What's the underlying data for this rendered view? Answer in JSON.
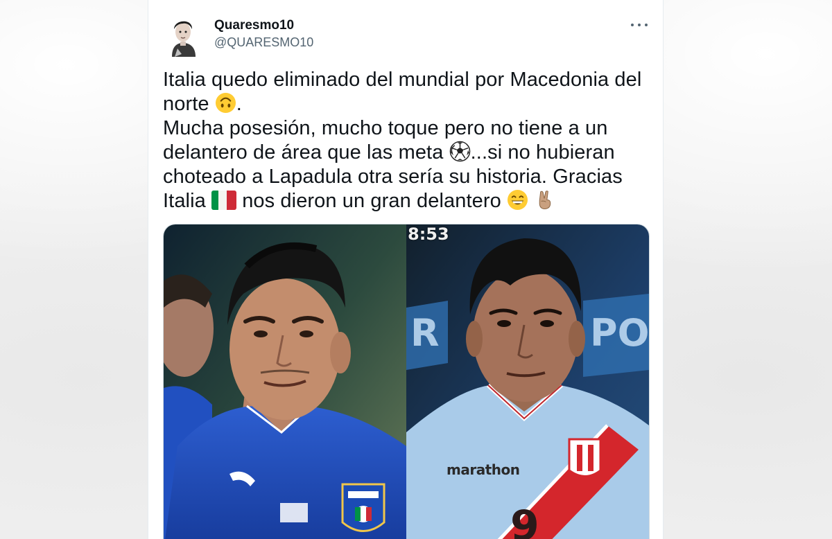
{
  "tweet": {
    "display_name": "Quaresmo10",
    "handle": "@QUARESMO10",
    "lines": [
      "Italia quedo eliminado del mundial por Macedonia del",
      "norte",
      ".",
      "Mucha posesión, mucho toque pero no tiene a un",
      "delantero de área que las meta",
      "...si no hubieran",
      "choteado a Lapadula otra sería su historia. Gracias",
      "Italia",
      "nos dieron un gran delantero"
    ],
    "emojis": {
      "upside_down": "upside-down-face-icon",
      "soccer_ball": "soccer-ball-icon",
      "italy_flag": "italy-flag-icon",
      "grin": "grinning-face-icon",
      "victory": "victory-hand-icon"
    }
  },
  "media": {
    "left_photo": "player-italy-jersey-photo",
    "right_photo": "player-peru-jersey-photo",
    "scoreboard_time": "8:53",
    "sponsor_text": "marathon"
  },
  "colors": {
    "text": "#0f1419",
    "secondary": "#536471",
    "italy_blue": "#1f4fbf",
    "peru_light_blue": "#9ec3e6",
    "peru_red": "#d4262c"
  }
}
